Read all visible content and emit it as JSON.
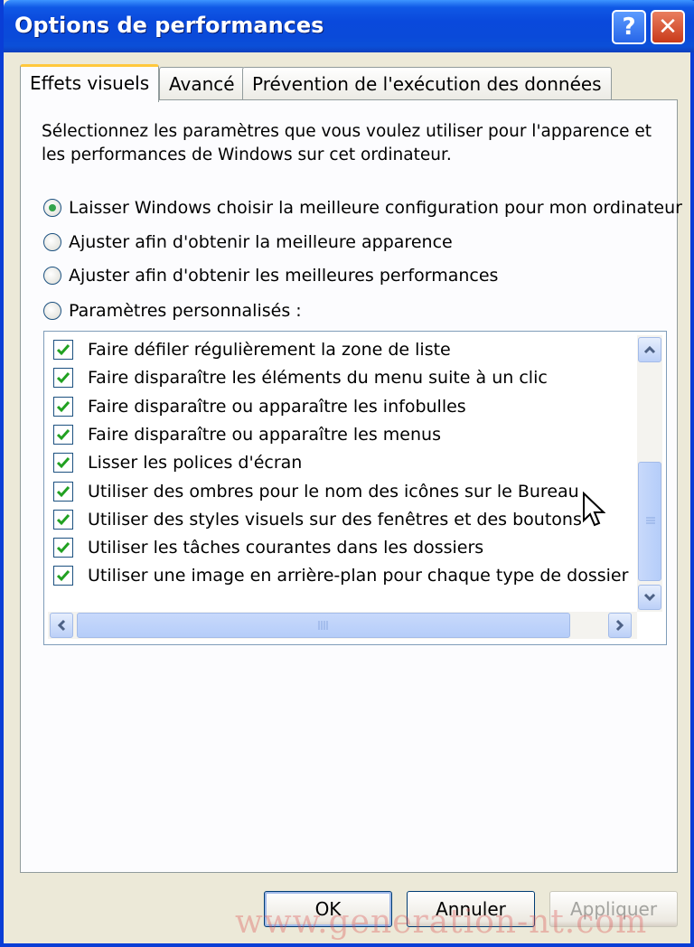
{
  "window": {
    "title": "Options de performances",
    "help_glyph": "?",
    "close_glyph": "✕"
  },
  "tabs": [
    {
      "label": "Effets visuels",
      "active": true
    },
    {
      "label": "Avancé",
      "active": false
    },
    {
      "label": "Prévention de l'exécution des données",
      "active": false
    }
  ],
  "panel": {
    "intro": "Sélectionnez les paramètres que vous voulez utiliser pour l'apparence et les performances de Windows sur cet ordinateur.",
    "radios": [
      {
        "label": "Laisser Windows choisir la meilleure configuration pour mon ordinateur",
        "checked": true
      },
      {
        "label": "Ajuster afin d'obtenir la meilleure apparence",
        "checked": false
      },
      {
        "label": "Ajuster afin d'obtenir les meilleures performances",
        "checked": false
      },
      {
        "label": "Paramètres personnalisés :",
        "checked": false
      }
    ],
    "list_items": [
      {
        "label": "Faire défiler régulièrement la zone de liste",
        "checked": true
      },
      {
        "label": "Faire disparaître les éléments du menu suite à un clic",
        "checked": true
      },
      {
        "label": "Faire disparaître ou apparaître les infobulles",
        "checked": true
      },
      {
        "label": "Faire disparaître ou apparaître les menus",
        "checked": true
      },
      {
        "label": "Lisser les polices d'écran",
        "checked": true
      },
      {
        "label": "Utiliser des ombres pour le nom des icônes sur le Bureau",
        "checked": true
      },
      {
        "label": "Utiliser des styles visuels sur des fenêtres et des boutons",
        "checked": true
      },
      {
        "label": "Utiliser les tâches courantes dans les dossiers",
        "checked": true
      },
      {
        "label": "Utiliser une image en arrière-plan pour chaque type de dossier",
        "checked": true
      }
    ]
  },
  "buttons": {
    "ok": "OK",
    "cancel": "Annuler",
    "apply": "Appliquer"
  },
  "watermark": "www.generation-nt.com",
  "colors": {
    "title_bar": "#0a49dc",
    "check_green": "#21a121",
    "panel_bg": "#fcfcfe",
    "window_bg": "#ece9d8"
  }
}
